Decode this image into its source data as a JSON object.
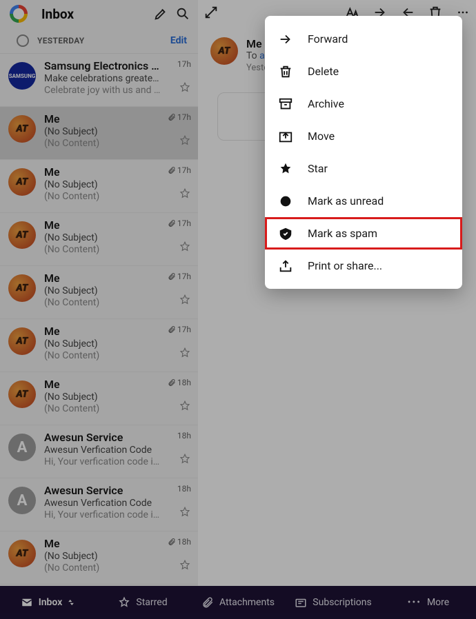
{
  "header": {
    "title": "Inbox"
  },
  "section": {
    "label": "YESTERDAY",
    "edit": "Edit"
  },
  "edit_link_color": "#2b6fd8",
  "messages": [
    {
      "avatar": "samsung",
      "avatarText": "SAMSUNG",
      "sender": "Samsung Electronics P...",
      "subject": "Make celebrations greater wi...",
      "preview": "Celebrate joy with us and get...",
      "time": "17h",
      "hasAttachment": false,
      "selected": false
    },
    {
      "avatar": "at",
      "avatarText": "AT",
      "sender": "Me",
      "subject": "(No Subject)",
      "preview": "(No Content)",
      "time": "17h",
      "hasAttachment": true,
      "selected": true
    },
    {
      "avatar": "at",
      "avatarText": "AT",
      "sender": "Me",
      "subject": "(No Subject)",
      "preview": "(No Content)",
      "time": "17h",
      "hasAttachment": true,
      "selected": false
    },
    {
      "avatar": "at",
      "avatarText": "AT",
      "sender": "Me",
      "subject": "(No Subject)",
      "preview": "(No Content)",
      "time": "17h",
      "hasAttachment": true,
      "selected": false
    },
    {
      "avatar": "at",
      "avatarText": "AT",
      "sender": "Me",
      "subject": "(No Subject)",
      "preview": "(No Content)",
      "time": "17h",
      "hasAttachment": true,
      "selected": false
    },
    {
      "avatar": "at",
      "avatarText": "AT",
      "sender": "Me",
      "subject": "(No Subject)",
      "preview": "(No Content)",
      "time": "17h",
      "hasAttachment": true,
      "selected": false
    },
    {
      "avatar": "at",
      "avatarText": "AT",
      "sender": "Me",
      "subject": "(No Subject)",
      "preview": "(No Content)",
      "time": "18h",
      "hasAttachment": true,
      "selected": false
    },
    {
      "avatar": "awesun",
      "avatarText": "A",
      "sender": "Awesun Service",
      "subject": "Awesun Verfication Code",
      "preview": "Hi,    Your verfication code is...",
      "time": "18h",
      "hasAttachment": false,
      "selected": false
    },
    {
      "avatar": "awesun",
      "avatarText": "A",
      "sender": "Awesun Service",
      "subject": "Awesun Verfication Code",
      "preview": "Hi,    Your verfication code is...",
      "time": "18h",
      "hasAttachment": false,
      "selected": false
    },
    {
      "avatar": "at",
      "avatarText": "AT",
      "sender": "Me",
      "subject": "(No Subject)",
      "preview": "(No Content)",
      "time": "18h",
      "hasAttachment": true,
      "selected": false
    }
  ],
  "reader": {
    "from": "Me",
    "toPrefix": "To ",
    "toLink": "al",
    "date": "Yeste"
  },
  "menu": [
    {
      "icon": "forward",
      "label": "Forward",
      "highlight": false
    },
    {
      "icon": "delete",
      "label": "Delete",
      "highlight": false
    },
    {
      "icon": "archive",
      "label": "Archive",
      "highlight": false
    },
    {
      "icon": "move",
      "label": "Move",
      "highlight": false
    },
    {
      "icon": "star",
      "label": "Star",
      "highlight": false
    },
    {
      "icon": "unread",
      "label": "Mark as unread",
      "highlight": false
    },
    {
      "icon": "spam",
      "label": "Mark as spam",
      "highlight": true
    },
    {
      "icon": "print",
      "label": "Print or share...",
      "highlight": false
    }
  ],
  "bottom": {
    "inbox": "Inbox",
    "starred": "Starred",
    "attachments": "Attachments",
    "subscriptions": "Subscriptions",
    "more": "More"
  }
}
